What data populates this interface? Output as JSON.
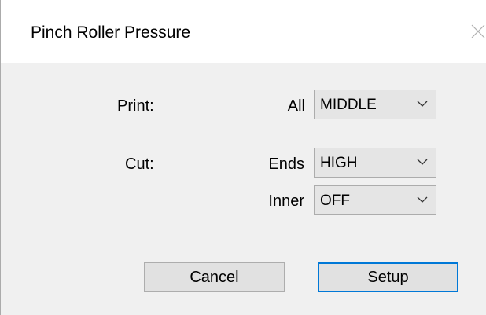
{
  "window": {
    "title": "Pinch Roller Pressure",
    "close_icon": "close-icon"
  },
  "print": {
    "label": "Print:",
    "all": {
      "label": "All",
      "value": "MIDDLE"
    }
  },
  "cut": {
    "label": "Cut:",
    "ends": {
      "label": "Ends",
      "value": "HIGH"
    },
    "inner": {
      "label": "Inner",
      "value": "OFF"
    }
  },
  "buttons": {
    "cancel": "Cancel",
    "setup": "Setup"
  },
  "colors": {
    "default_button_border": "#0078d7",
    "titlebar": "#ffffff",
    "dialog_background": "#f0f0f0"
  }
}
